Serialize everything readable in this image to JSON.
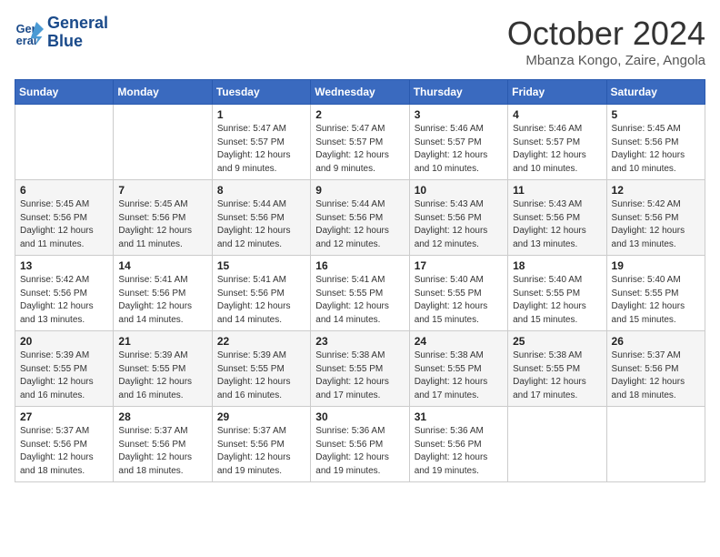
{
  "logo": {
    "line1": "General",
    "line2": "Blue"
  },
  "title": "October 2024",
  "location": "Mbanza Kongo, Zaire, Angola",
  "days_header": [
    "Sunday",
    "Monday",
    "Tuesday",
    "Wednesday",
    "Thursday",
    "Friday",
    "Saturday"
  ],
  "weeks": [
    [
      {
        "num": "",
        "sunrise": "",
        "sunset": "",
        "daylight": ""
      },
      {
        "num": "",
        "sunrise": "",
        "sunset": "",
        "daylight": ""
      },
      {
        "num": "1",
        "sunrise": "Sunrise: 5:47 AM",
        "sunset": "Sunset: 5:57 PM",
        "daylight": "Daylight: 12 hours and 9 minutes."
      },
      {
        "num": "2",
        "sunrise": "Sunrise: 5:47 AM",
        "sunset": "Sunset: 5:57 PM",
        "daylight": "Daylight: 12 hours and 9 minutes."
      },
      {
        "num": "3",
        "sunrise": "Sunrise: 5:46 AM",
        "sunset": "Sunset: 5:57 PM",
        "daylight": "Daylight: 12 hours and 10 minutes."
      },
      {
        "num": "4",
        "sunrise": "Sunrise: 5:46 AM",
        "sunset": "Sunset: 5:57 PM",
        "daylight": "Daylight: 12 hours and 10 minutes."
      },
      {
        "num": "5",
        "sunrise": "Sunrise: 5:45 AM",
        "sunset": "Sunset: 5:56 PM",
        "daylight": "Daylight: 12 hours and 10 minutes."
      }
    ],
    [
      {
        "num": "6",
        "sunrise": "Sunrise: 5:45 AM",
        "sunset": "Sunset: 5:56 PM",
        "daylight": "Daylight: 12 hours and 11 minutes."
      },
      {
        "num": "7",
        "sunrise": "Sunrise: 5:45 AM",
        "sunset": "Sunset: 5:56 PM",
        "daylight": "Daylight: 12 hours and 11 minutes."
      },
      {
        "num": "8",
        "sunrise": "Sunrise: 5:44 AM",
        "sunset": "Sunset: 5:56 PM",
        "daylight": "Daylight: 12 hours and 12 minutes."
      },
      {
        "num": "9",
        "sunrise": "Sunrise: 5:44 AM",
        "sunset": "Sunset: 5:56 PM",
        "daylight": "Daylight: 12 hours and 12 minutes."
      },
      {
        "num": "10",
        "sunrise": "Sunrise: 5:43 AM",
        "sunset": "Sunset: 5:56 PM",
        "daylight": "Daylight: 12 hours and 12 minutes."
      },
      {
        "num": "11",
        "sunrise": "Sunrise: 5:43 AM",
        "sunset": "Sunset: 5:56 PM",
        "daylight": "Daylight: 12 hours and 13 minutes."
      },
      {
        "num": "12",
        "sunrise": "Sunrise: 5:42 AM",
        "sunset": "Sunset: 5:56 PM",
        "daylight": "Daylight: 12 hours and 13 minutes."
      }
    ],
    [
      {
        "num": "13",
        "sunrise": "Sunrise: 5:42 AM",
        "sunset": "Sunset: 5:56 PM",
        "daylight": "Daylight: 12 hours and 13 minutes."
      },
      {
        "num": "14",
        "sunrise": "Sunrise: 5:41 AM",
        "sunset": "Sunset: 5:56 PM",
        "daylight": "Daylight: 12 hours and 14 minutes."
      },
      {
        "num": "15",
        "sunrise": "Sunrise: 5:41 AM",
        "sunset": "Sunset: 5:56 PM",
        "daylight": "Daylight: 12 hours and 14 minutes."
      },
      {
        "num": "16",
        "sunrise": "Sunrise: 5:41 AM",
        "sunset": "Sunset: 5:55 PM",
        "daylight": "Daylight: 12 hours and 14 minutes."
      },
      {
        "num": "17",
        "sunrise": "Sunrise: 5:40 AM",
        "sunset": "Sunset: 5:55 PM",
        "daylight": "Daylight: 12 hours and 15 minutes."
      },
      {
        "num": "18",
        "sunrise": "Sunrise: 5:40 AM",
        "sunset": "Sunset: 5:55 PM",
        "daylight": "Daylight: 12 hours and 15 minutes."
      },
      {
        "num": "19",
        "sunrise": "Sunrise: 5:40 AM",
        "sunset": "Sunset: 5:55 PM",
        "daylight": "Daylight: 12 hours and 15 minutes."
      }
    ],
    [
      {
        "num": "20",
        "sunrise": "Sunrise: 5:39 AM",
        "sunset": "Sunset: 5:55 PM",
        "daylight": "Daylight: 12 hours and 16 minutes."
      },
      {
        "num": "21",
        "sunrise": "Sunrise: 5:39 AM",
        "sunset": "Sunset: 5:55 PM",
        "daylight": "Daylight: 12 hours and 16 minutes."
      },
      {
        "num": "22",
        "sunrise": "Sunrise: 5:39 AM",
        "sunset": "Sunset: 5:55 PM",
        "daylight": "Daylight: 12 hours and 16 minutes."
      },
      {
        "num": "23",
        "sunrise": "Sunrise: 5:38 AM",
        "sunset": "Sunset: 5:55 PM",
        "daylight": "Daylight: 12 hours and 17 minutes."
      },
      {
        "num": "24",
        "sunrise": "Sunrise: 5:38 AM",
        "sunset": "Sunset: 5:55 PM",
        "daylight": "Daylight: 12 hours and 17 minutes."
      },
      {
        "num": "25",
        "sunrise": "Sunrise: 5:38 AM",
        "sunset": "Sunset: 5:55 PM",
        "daylight": "Daylight: 12 hours and 17 minutes."
      },
      {
        "num": "26",
        "sunrise": "Sunrise: 5:37 AM",
        "sunset": "Sunset: 5:56 PM",
        "daylight": "Daylight: 12 hours and 18 minutes."
      }
    ],
    [
      {
        "num": "27",
        "sunrise": "Sunrise: 5:37 AM",
        "sunset": "Sunset: 5:56 PM",
        "daylight": "Daylight: 12 hours and 18 minutes."
      },
      {
        "num": "28",
        "sunrise": "Sunrise: 5:37 AM",
        "sunset": "Sunset: 5:56 PM",
        "daylight": "Daylight: 12 hours and 18 minutes."
      },
      {
        "num": "29",
        "sunrise": "Sunrise: 5:37 AM",
        "sunset": "Sunset: 5:56 PM",
        "daylight": "Daylight: 12 hours and 19 minutes."
      },
      {
        "num": "30",
        "sunrise": "Sunrise: 5:36 AM",
        "sunset": "Sunset: 5:56 PM",
        "daylight": "Daylight: 12 hours and 19 minutes."
      },
      {
        "num": "31",
        "sunrise": "Sunrise: 5:36 AM",
        "sunset": "Sunset: 5:56 PM",
        "daylight": "Daylight: 12 hours and 19 minutes."
      },
      {
        "num": "",
        "sunrise": "",
        "sunset": "",
        "daylight": ""
      },
      {
        "num": "",
        "sunrise": "",
        "sunset": "",
        "daylight": ""
      }
    ]
  ]
}
